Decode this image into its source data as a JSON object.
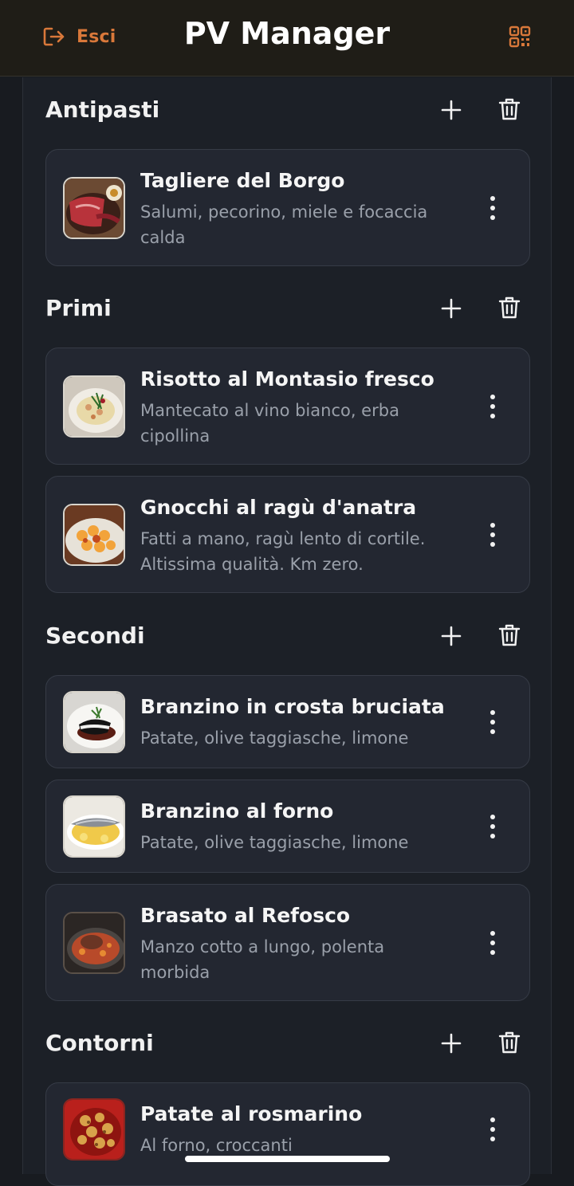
{
  "header": {
    "logout_label": "Esci",
    "title": "PV Manager",
    "logout_icon": "logout-icon",
    "qr_icon": "qr-code-icon"
  },
  "colors": {
    "accent": "#d9783a",
    "header_bg": "#1f1d17",
    "card_bg": "#232731",
    "text_secondary": "#9aa0aa"
  },
  "sections": [
    {
      "title": "Antipasti",
      "items": [
        {
          "title": "Tagliere del Borgo",
          "desc": "Salumi, pecorino, miele e focaccia calda"
        }
      ]
    },
    {
      "title": "Primi",
      "items": [
        {
          "title": "Risotto al Montasio fresco",
          "desc": "Mantecato al vino bianco, erba cipollina"
        },
        {
          "title": "Gnocchi al ragù d'anatra",
          "desc": "Fatti a mano, ragù lento di cortile. Altissima qualità. Km zero."
        }
      ]
    },
    {
      "title": "Secondi",
      "items": [
        {
          "title": "Branzino in crosta bruciata",
          "desc": "Patate, olive taggiasche, limone"
        },
        {
          "title": "Branzino al forno",
          "desc": "Patate, olive taggiasche, limone"
        },
        {
          "title": "Brasato al Refosco",
          "desc": "Manzo cotto a lungo, polenta morbida"
        }
      ]
    },
    {
      "title": "Contorni",
      "items": [
        {
          "title": "Patate al rosmarino",
          "desc": "Al forno, croccanti"
        }
      ]
    }
  ]
}
